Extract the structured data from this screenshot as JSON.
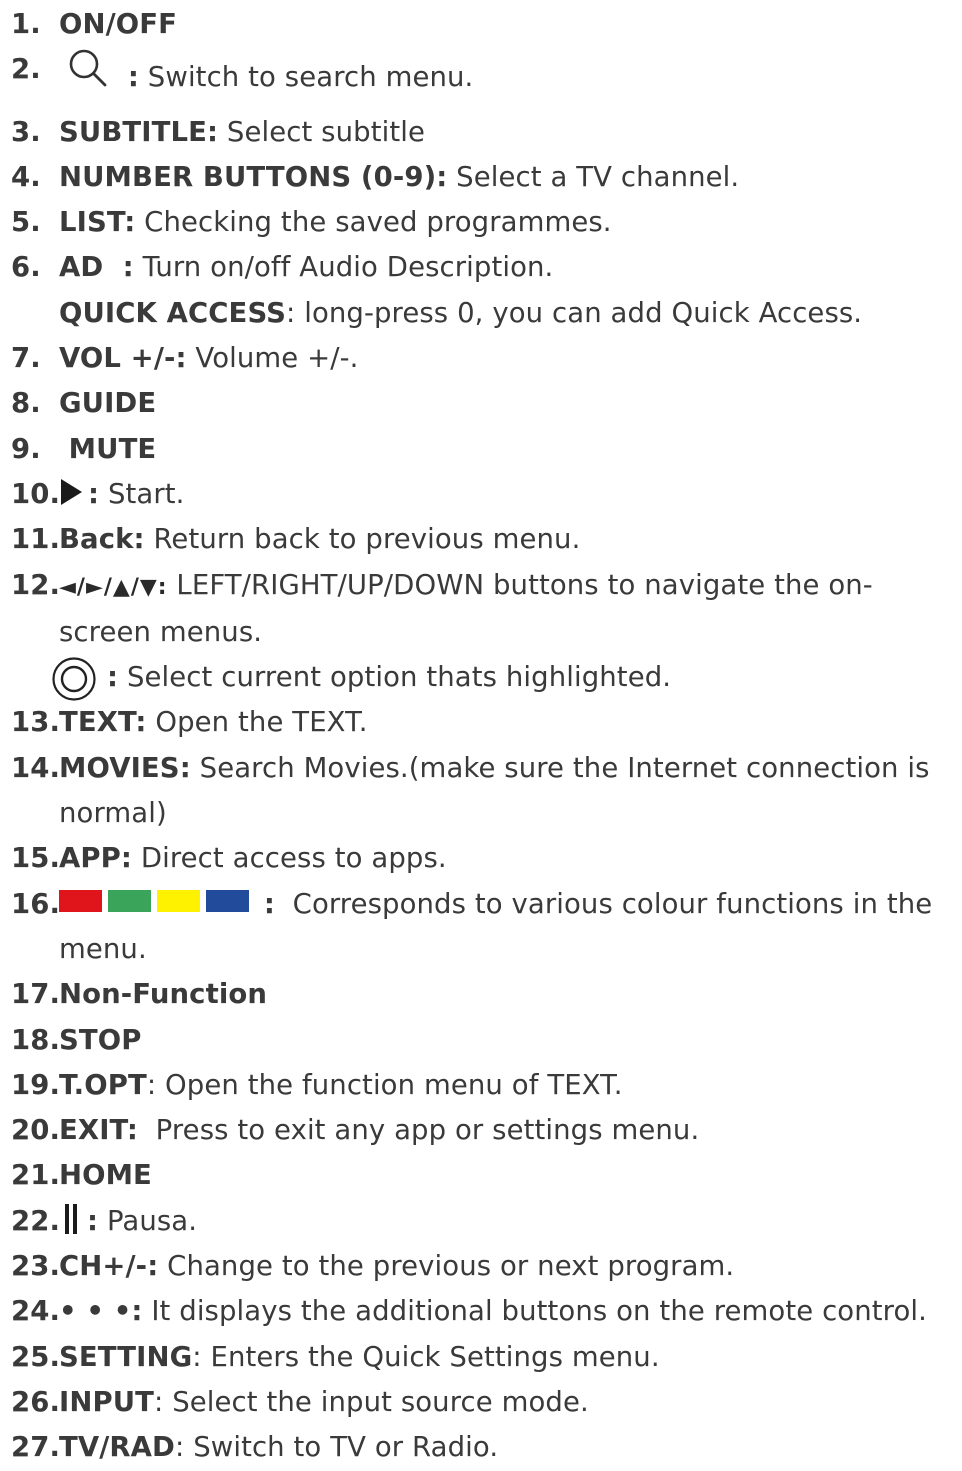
{
  "items": [
    {
      "num": "1.",
      "label": "ON/OFF",
      "desc": ""
    },
    {
      "num": "2.",
      "icon": "search-icon",
      "sep": ":",
      "desc": " Switch to search menu."
    },
    {
      "num": "3.",
      "label": "SUBTITLE:",
      "desc": " Select subtitle"
    },
    {
      "num": "4.",
      "label": "NUMBER BUTTONS (0-9):",
      "desc": " Select a TV channel."
    },
    {
      "num": "5.",
      "label": "LIST:",
      "desc": " Checking the saved programmes."
    },
    {
      "num": "6.",
      "label": "AD  :",
      "desc": " Turn on/off Audio Description.",
      "cont_label": "QUICK ACCESS",
      "cont_desc": ": long-press 0, you can add Quick Access."
    },
    {
      "num": "7.",
      "label": "VOL +/-:",
      "desc": " Volume +/-."
    },
    {
      "num": "8.",
      "label": "GUIDE",
      "desc": ""
    },
    {
      "num": "9.",
      "label": " MUTE",
      "desc": ""
    },
    {
      "num": "10.",
      "icon": "play-icon",
      "sep": ":",
      "desc": " Start."
    },
    {
      "num": "11.",
      "label": "Back:",
      "desc": " Return back to previous menu."
    },
    {
      "num": "12.",
      "arrows": "◄/►/▲/▼:",
      "desc": " LEFT/RIGHT/UP/DOWN buttons to navigate the on-",
      "cont_desc": "screen menus.",
      "ok_desc": " Select current option thats highlighted.",
      "ok_sep": ":"
    },
    {
      "num": "13.",
      "label": "TEXT:",
      "desc": " Open the TEXT."
    },
    {
      "num": "14.",
      "label": "MOVIES:",
      "desc": " Search Movies.(make sure the Internet connection is",
      "cont_desc": "normal)"
    },
    {
      "num": "15.",
      "label": "APP:",
      "desc": " Direct access to apps."
    },
    {
      "num": "16.",
      "swatches": [
        "#e0141b",
        "#3aa55a",
        "#fff200",
        "#234b9b"
      ],
      "sep": ":",
      "desc": "  Corresponds to various colour functions in the",
      "cont_desc": "menu."
    },
    {
      "num": "17.",
      "label": "Non-Function",
      "desc": ""
    },
    {
      "num": "18.",
      "label": "STOP",
      "desc": ""
    },
    {
      "num": "19.",
      "label": "T.OPT",
      "desc": ": Open the function menu of TEXT."
    },
    {
      "num": "20.",
      "label": "EXIT:",
      "desc": "  Press to exit any app or settings menu."
    },
    {
      "num": "21.",
      "label": "HOME",
      "desc": ""
    },
    {
      "num": "22.",
      "icon": "pause-icon",
      "sep": ":",
      "desc": " Pausa."
    },
    {
      "num": "23.",
      "label": "CH+/-:",
      "desc": " Change to the previous or next program."
    },
    {
      "num": "24.",
      "label": "• • •:",
      "desc": " It displays the additional buttons on the remote control."
    },
    {
      "num": "25.",
      "label": "SETTING",
      "desc": ": Enters the Quick Settings menu."
    },
    {
      "num": "26.",
      "label": "INPUT",
      "desc": ": Select the input source mode."
    },
    {
      "num": "27.",
      "label": "TV/RAD",
      "desc": ": Switch to TV or Radio."
    }
  ]
}
